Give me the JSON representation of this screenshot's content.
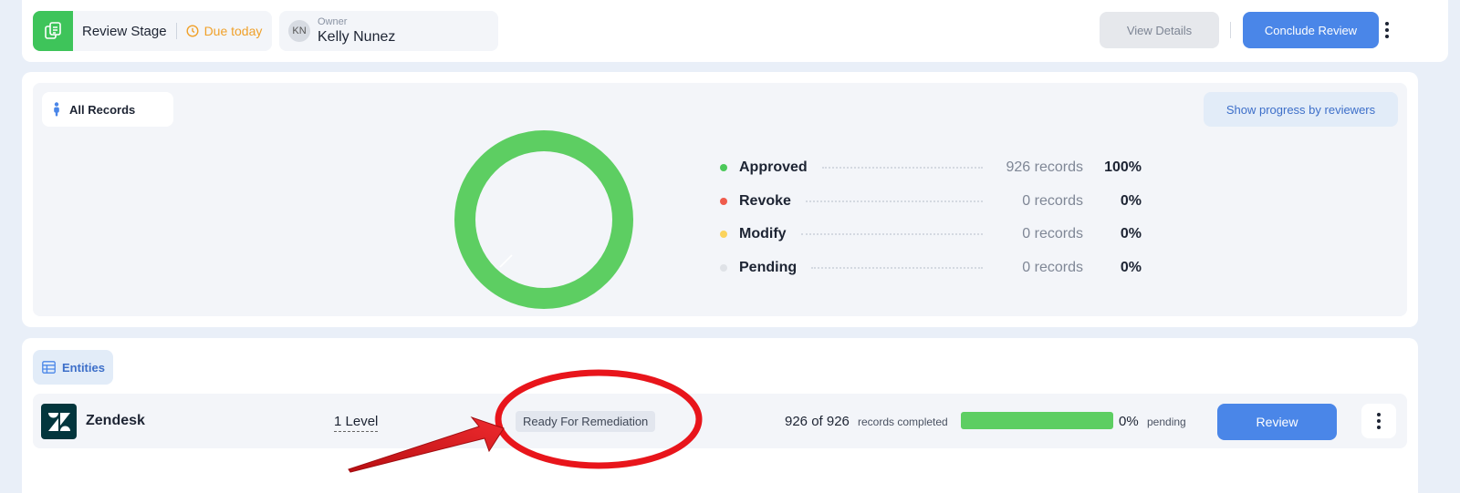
{
  "header": {
    "stage_label": "Review Stage",
    "due_label": "Due today",
    "owner_initials": "KN",
    "owner_caption": "Owner",
    "owner_name": "Kelly Nunez",
    "view_details_label": "View Details",
    "conclude_label": "Conclude Review"
  },
  "summary": {
    "filter_label": "All Records",
    "progress_button_label": "Show progress by reviewers",
    "legend": [
      {
        "label": "Approved",
        "count": "926 records",
        "percent": "100%",
        "color": "#4cc95a"
      },
      {
        "label": "Revoke",
        "count": "0 records",
        "percent": "0%",
        "color": "#ef5b4c"
      },
      {
        "label": "Modify",
        "count": "0 records",
        "percent": "0%",
        "color": "#fbd35c"
      },
      {
        "label": "Pending",
        "count": "0 records",
        "percent": "0%",
        "color": "#dfe2e7"
      }
    ]
  },
  "entities": {
    "tab_label": "Entities",
    "rows": [
      {
        "name": "Zendesk",
        "level": "1 Level",
        "status": "Ready For Remediation",
        "completed": "926 of 926",
        "completed_suffix": "records completed",
        "progress_fraction": 1.0,
        "pending_percent": "0%",
        "pending_label": "pending",
        "action_label": "Review"
      }
    ]
  },
  "colors": {
    "primary": "#4a86e8",
    "approved": "#5dce62",
    "due": "#f0a12a",
    "annotation": "#e8151b"
  },
  "icons": {
    "stage": "review-stage-icon",
    "due": "clock-icon",
    "filter": "person-icon",
    "entities": "table-icon",
    "logo": "zendesk-logo-icon",
    "menu": "more-vertical-icon"
  }
}
